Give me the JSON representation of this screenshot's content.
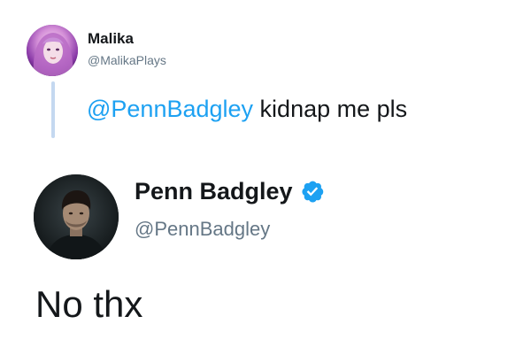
{
  "quoted_tweet": {
    "author_name": "Malika",
    "author_handle": "@MalikaPlays",
    "mention": "@PennBadgley",
    "text_after_mention": " kidnap me pls"
  },
  "reply_tweet": {
    "author_name": "Penn Badgley",
    "author_handle": "@PennBadgley",
    "verified_icon": "verified-badge-icon",
    "text": "No thx"
  },
  "colors": {
    "link_blue": "#1da1f2",
    "handle_gray": "#657786",
    "text_dark": "#14171a",
    "thread_line": "#c4d8f0"
  }
}
